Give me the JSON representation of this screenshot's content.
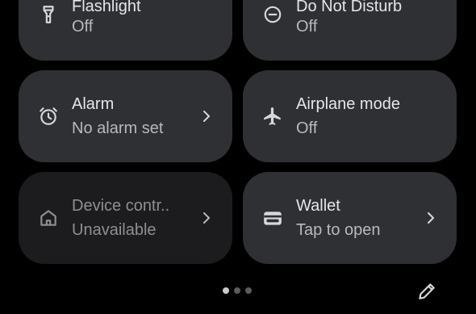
{
  "tiles": {
    "flashlight": {
      "label": "Flashlight",
      "status": "Off",
      "icon": "flashlight-icon"
    },
    "dnd": {
      "label": "Do Not Disturb",
      "status": "Off",
      "icon": "do-not-disturb-icon"
    },
    "alarm": {
      "label": "Alarm",
      "status": "No alarm set",
      "icon": "alarm-clock-icon"
    },
    "airplane": {
      "label": "Airplane mode",
      "status": "Off",
      "icon": "airplane-icon"
    },
    "device_controls": {
      "label": "Device contr..",
      "status": "Unavailable",
      "icon": "home-icon"
    },
    "wallet": {
      "label": "Wallet",
      "status": "Tap to open",
      "icon": "wallet-icon"
    }
  },
  "pager": {
    "pages": 3,
    "current": 1
  },
  "colors": {
    "background": "#000000",
    "tile": "#2f3033",
    "tile_disabled": "#1c1c1e",
    "text_primary": "#e6e6e9",
    "text_secondary": "#b8b9bd"
  }
}
